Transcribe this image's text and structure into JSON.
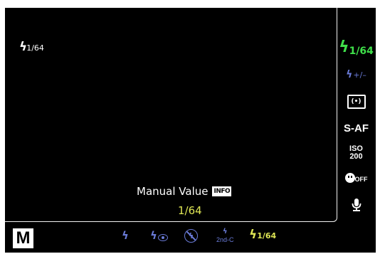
{
  "viewfinder": {
    "flash_indicator_value": "1/64",
    "prompt_label": "Manual Value",
    "info_badge": "INFO",
    "selected_value": "1/64"
  },
  "right_panel": {
    "flash_mode_value": "1/64",
    "flash_comp_value": "+/–",
    "metering_symbol": "(•)",
    "af_mode": "S-AF",
    "iso_label": "ISO",
    "iso_value": "200",
    "face_priority_label": "OFF",
    "icons": [
      "flash-icon",
      "flash-compensation-icon",
      "metering-icon",
      "face-priority-icon",
      "microphone-icon"
    ]
  },
  "bottom_bar": {
    "shooting_mode": "M",
    "flash_options": [
      {
        "name": "auto-flash",
        "label": ""
      },
      {
        "name": "red-eye-reduction",
        "label": ""
      },
      {
        "name": "flash-off",
        "label": ""
      },
      {
        "name": "2nd-curtain",
        "label": "2nd-C"
      },
      {
        "name": "manual-flash",
        "label": "1/64"
      }
    ]
  },
  "colors": {
    "background": "#000000",
    "selected_green": "#3fe04a",
    "value_yellow": "#dfe655",
    "option_blue": "#6a7bd8",
    "text_white": "#ffffff"
  }
}
